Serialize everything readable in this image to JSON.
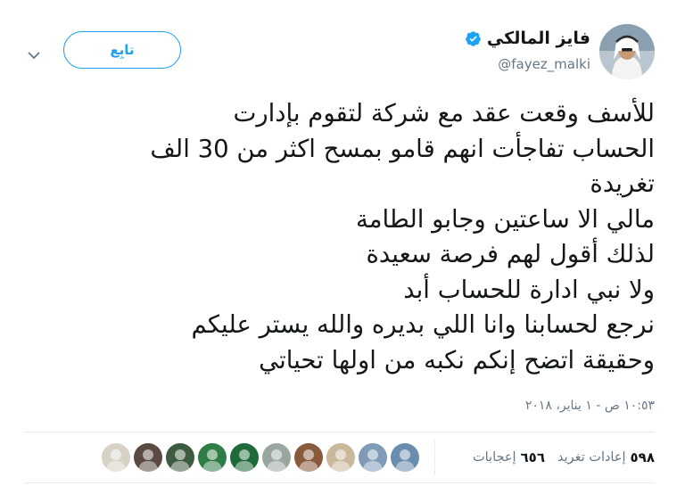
{
  "author": {
    "name": "فايز المالكي",
    "handle": "@fayez_malki",
    "verified": true,
    "avatar_icon": "profile-photo-icon"
  },
  "actions": {
    "follow_label": "تابِع",
    "menu_icon": "chevron-down-icon"
  },
  "tweet": {
    "lines": [
      "للأسف وقعت عقد مع شركة لتقوم بإدارت",
      "الحساب تفاجأت انهم قامو بمسح اكثر من 30 الف",
      "تغريدة",
      " مالي الا ساعتين وجابو الطامة",
      "لذلك أقول لهم فرصة سعيدة",
      "ولا نبي ادارة للحساب أبد",
      "نرجع لحسابنا وانا اللي بديره والله يستر عليكم",
      "وحقيقة اتضح إنكم نكبه من اولها تحياتي"
    ],
    "timestamp": "١٠:٥٣ ص - ١ يناير، ٢٠١٨"
  },
  "stats": {
    "retweets_count": "٥٩٨",
    "retweets_label": "إعادات تغريد",
    "likes_count": "٦٥٦",
    "likes_label": "إعجابات"
  },
  "likers": [
    {
      "name": "liker-avatar-1",
      "color": "#6a8caf"
    },
    {
      "name": "liker-avatar-2",
      "color": "#7f9bb8"
    },
    {
      "name": "liker-avatar-3",
      "color": "#c9b89a"
    },
    {
      "name": "liker-avatar-4",
      "color": "#8a5a3c"
    },
    {
      "name": "liker-avatar-5",
      "color": "#9aa6a0"
    },
    {
      "name": "liker-avatar-6",
      "color": "#1e6b3a"
    },
    {
      "name": "liker-avatar-7",
      "color": "#2f7d46"
    },
    {
      "name": "liker-avatar-8",
      "color": "#3d5c3f"
    },
    {
      "name": "liker-avatar-9",
      "color": "#5a4a42"
    },
    {
      "name": "liker-avatar-10",
      "color": "#d8d2c6"
    }
  ],
  "colors": {
    "accent": "#1da1f2",
    "text": "#14171a",
    "muted": "#657786",
    "divider": "#e6ecf0"
  }
}
